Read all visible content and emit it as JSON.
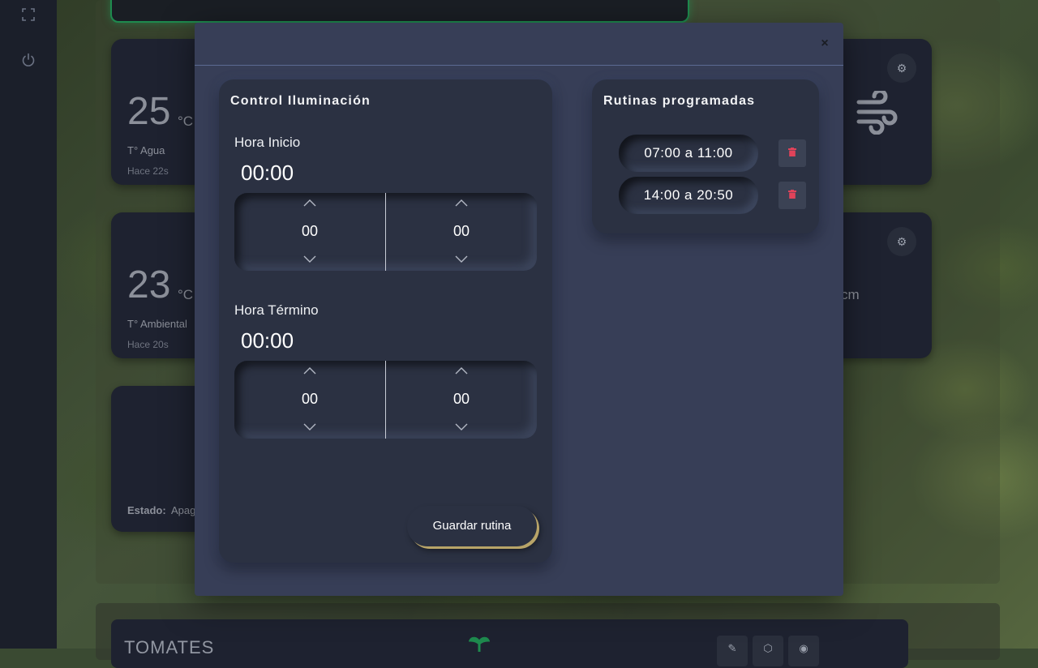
{
  "background": {
    "cards": [
      {
        "value": "25",
        "unit": "°C",
        "label": "T° Agua",
        "ago": "Hace 22s"
      },
      {
        "value": "23",
        "unit": "°C",
        "label": "T° Ambiental",
        "ago": "Hace 20s"
      }
    ],
    "state_label": "Estado:",
    "state_value": "Apag",
    "partial_unit": "cm",
    "bottom_title": "TOMATES"
  },
  "modal": {
    "close_symbol": "×",
    "control_panel": {
      "title": "Control Iluminación",
      "start": {
        "label": "Hora Inicio",
        "display": "00:00",
        "hours": "00",
        "minutes": "00"
      },
      "end": {
        "label": "Hora Término",
        "display": "00:00",
        "hours": "00",
        "minutes": "00"
      },
      "save_label": "Guardar rutina"
    },
    "routines_panel": {
      "title": "Rutinas programadas",
      "routines": [
        {
          "label": "07:00 a 11:00"
        },
        {
          "label": "14:00 a 20:50"
        }
      ]
    }
  },
  "colors": {
    "modal_bg": "#373e57",
    "panel_bg": "#2b3142",
    "trash_red": "#e0435a",
    "accent_gold": "#b8a468",
    "active_green": "#1e8a4e"
  }
}
